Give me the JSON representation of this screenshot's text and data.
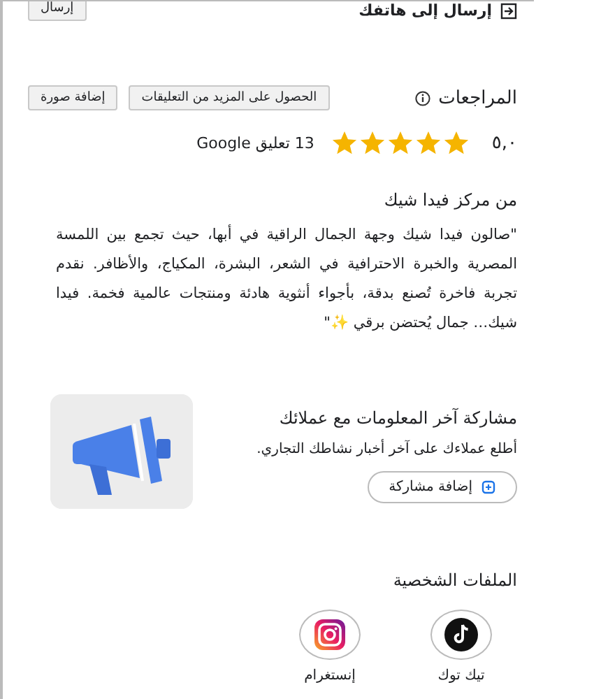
{
  "send_to_phone": {
    "label": "إرسال إلى هاتفك",
    "button": "إرسال"
  },
  "reviews": {
    "title": "المراجعات",
    "buttons": [
      "الحصول على المزيد من التعليقات",
      "إضافة صورة"
    ],
    "rating": "٥,٠",
    "stars": 5,
    "count": "13 تعليق Google"
  },
  "description": {
    "title": "من مركز فيدا شيك",
    "text": "\"صالون فيدا شيك وجهة الجمال الراقية في أبها، حيث تجمع بين اللمسة المصرية والخبرة الاحترافية في الشعر، البشرة، المكياج، والأظافر. نقدم تجربة فاخرة تُصنع بدقة، بأجواء أنثوية هادئة ومنتجات عالمية فخمة. فيدا شيك… جمال يُحتضن برقي ✨\""
  },
  "post_card": {
    "title": "مشاركة آخر المعلومات مع عملائك",
    "text": "أطلع عملاءك على آخر أخبار نشاطك التجاري.",
    "button": "إضافة مشاركة"
  },
  "profiles": {
    "title": "الملفات الشخصية",
    "items": [
      {
        "kind": "tiktok",
        "label": "تيك توك"
      },
      {
        "kind": "instagram",
        "label": "إنستغرام"
      }
    ]
  }
}
